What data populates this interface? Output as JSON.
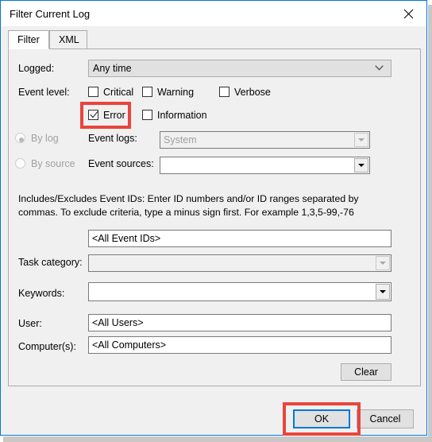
{
  "window": {
    "title": "Filter Current Log",
    "close_icon": "close-icon"
  },
  "tabs": [
    {
      "label": "Filter",
      "active": true
    },
    {
      "label": "XML",
      "active": false
    }
  ],
  "form": {
    "logged": {
      "label": "Logged:",
      "value": "Any time",
      "icon": "chevron-down-icon"
    },
    "event_level": {
      "label": "Event level:",
      "checkboxes": [
        {
          "label": "Critical",
          "checked": false
        },
        {
          "label": "Warning",
          "checked": false
        },
        {
          "label": "Verbose",
          "checked": false
        },
        {
          "label": "Error",
          "checked": true
        },
        {
          "label": "Information",
          "checked": false
        }
      ]
    },
    "source_mode": {
      "by_log": {
        "label": "By log",
        "selected": true,
        "disabled": true
      },
      "by_source": {
        "label": "By source",
        "selected": false,
        "disabled": true
      }
    },
    "event_logs": {
      "label": "Event logs:",
      "value": "System",
      "disabled": true,
      "icon": "dropdown-arrow-icon"
    },
    "event_sources": {
      "label": "Event sources:",
      "value": "",
      "disabled": false,
      "icon": "dropdown-arrow-icon"
    },
    "event_ids_description": "Includes/Excludes Event IDs: Enter ID numbers and/or ID ranges separated by commas. To exclude criteria, type a minus sign first. For example 1,3,5-99,-76",
    "event_ids": {
      "value": "<All Event IDs>"
    },
    "task_category": {
      "label": "Task category:",
      "value": "",
      "disabled": true,
      "icon": "dropdown-arrow-icon"
    },
    "keywords": {
      "label": "Keywords:",
      "value": "",
      "disabled": false,
      "icon": "dropdown-arrow-icon"
    },
    "user": {
      "label": "User:",
      "value": "<All Users>"
    },
    "computers": {
      "label": "Computer(s):",
      "value": "<All Computers>"
    },
    "clear_button": "Clear"
  },
  "footer": {
    "ok_button": "OK",
    "cancel_button": "Cancel"
  },
  "annotations": {
    "highlight_color": "#e8453c",
    "focus_color": "#0078d7",
    "targets": [
      "error-checkbox",
      "ok-button"
    ]
  }
}
